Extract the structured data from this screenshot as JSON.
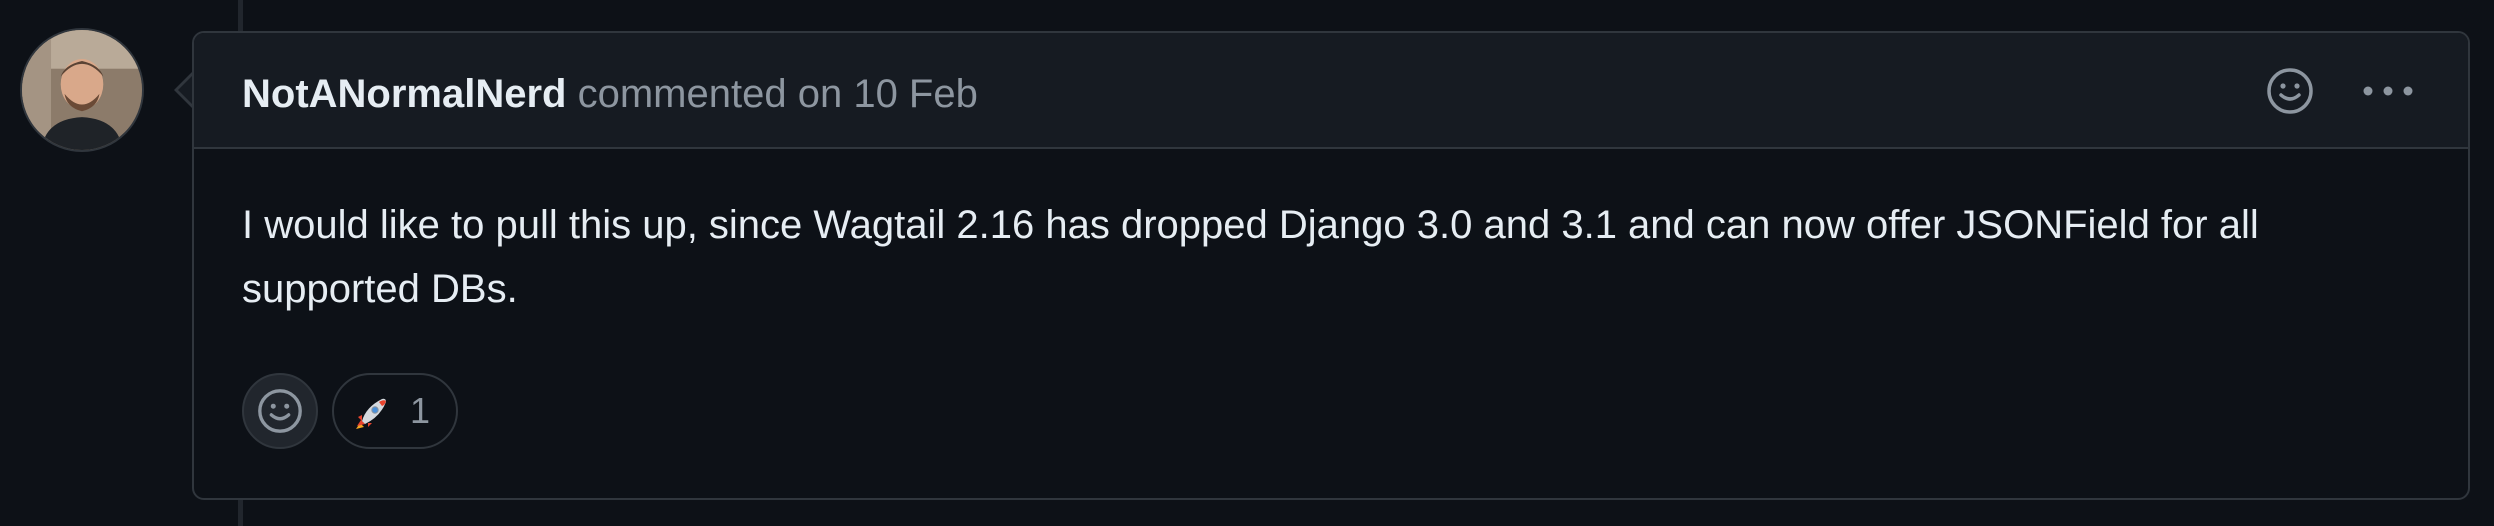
{
  "comment": {
    "author": "NotANormalNerd",
    "action": "commented on",
    "date": "10 Feb",
    "body": "I would like to pull this up, since Wagtail 2.16 has dropped Django 3.0 and 3.1 and can now offer JSONField for all supported DBs.",
    "reactions": [
      {
        "emoji": "rocket",
        "count": "1"
      }
    ]
  },
  "icons": {
    "header_reaction": "smiley-icon",
    "header_menu": "kebab-horizontal-icon",
    "add_reaction": "smiley-icon"
  },
  "colors": {
    "background": "#0d1117",
    "header_background": "#161b22",
    "border": "#30363d",
    "text": "#e6edf3",
    "muted_text": "#8d96a0"
  }
}
